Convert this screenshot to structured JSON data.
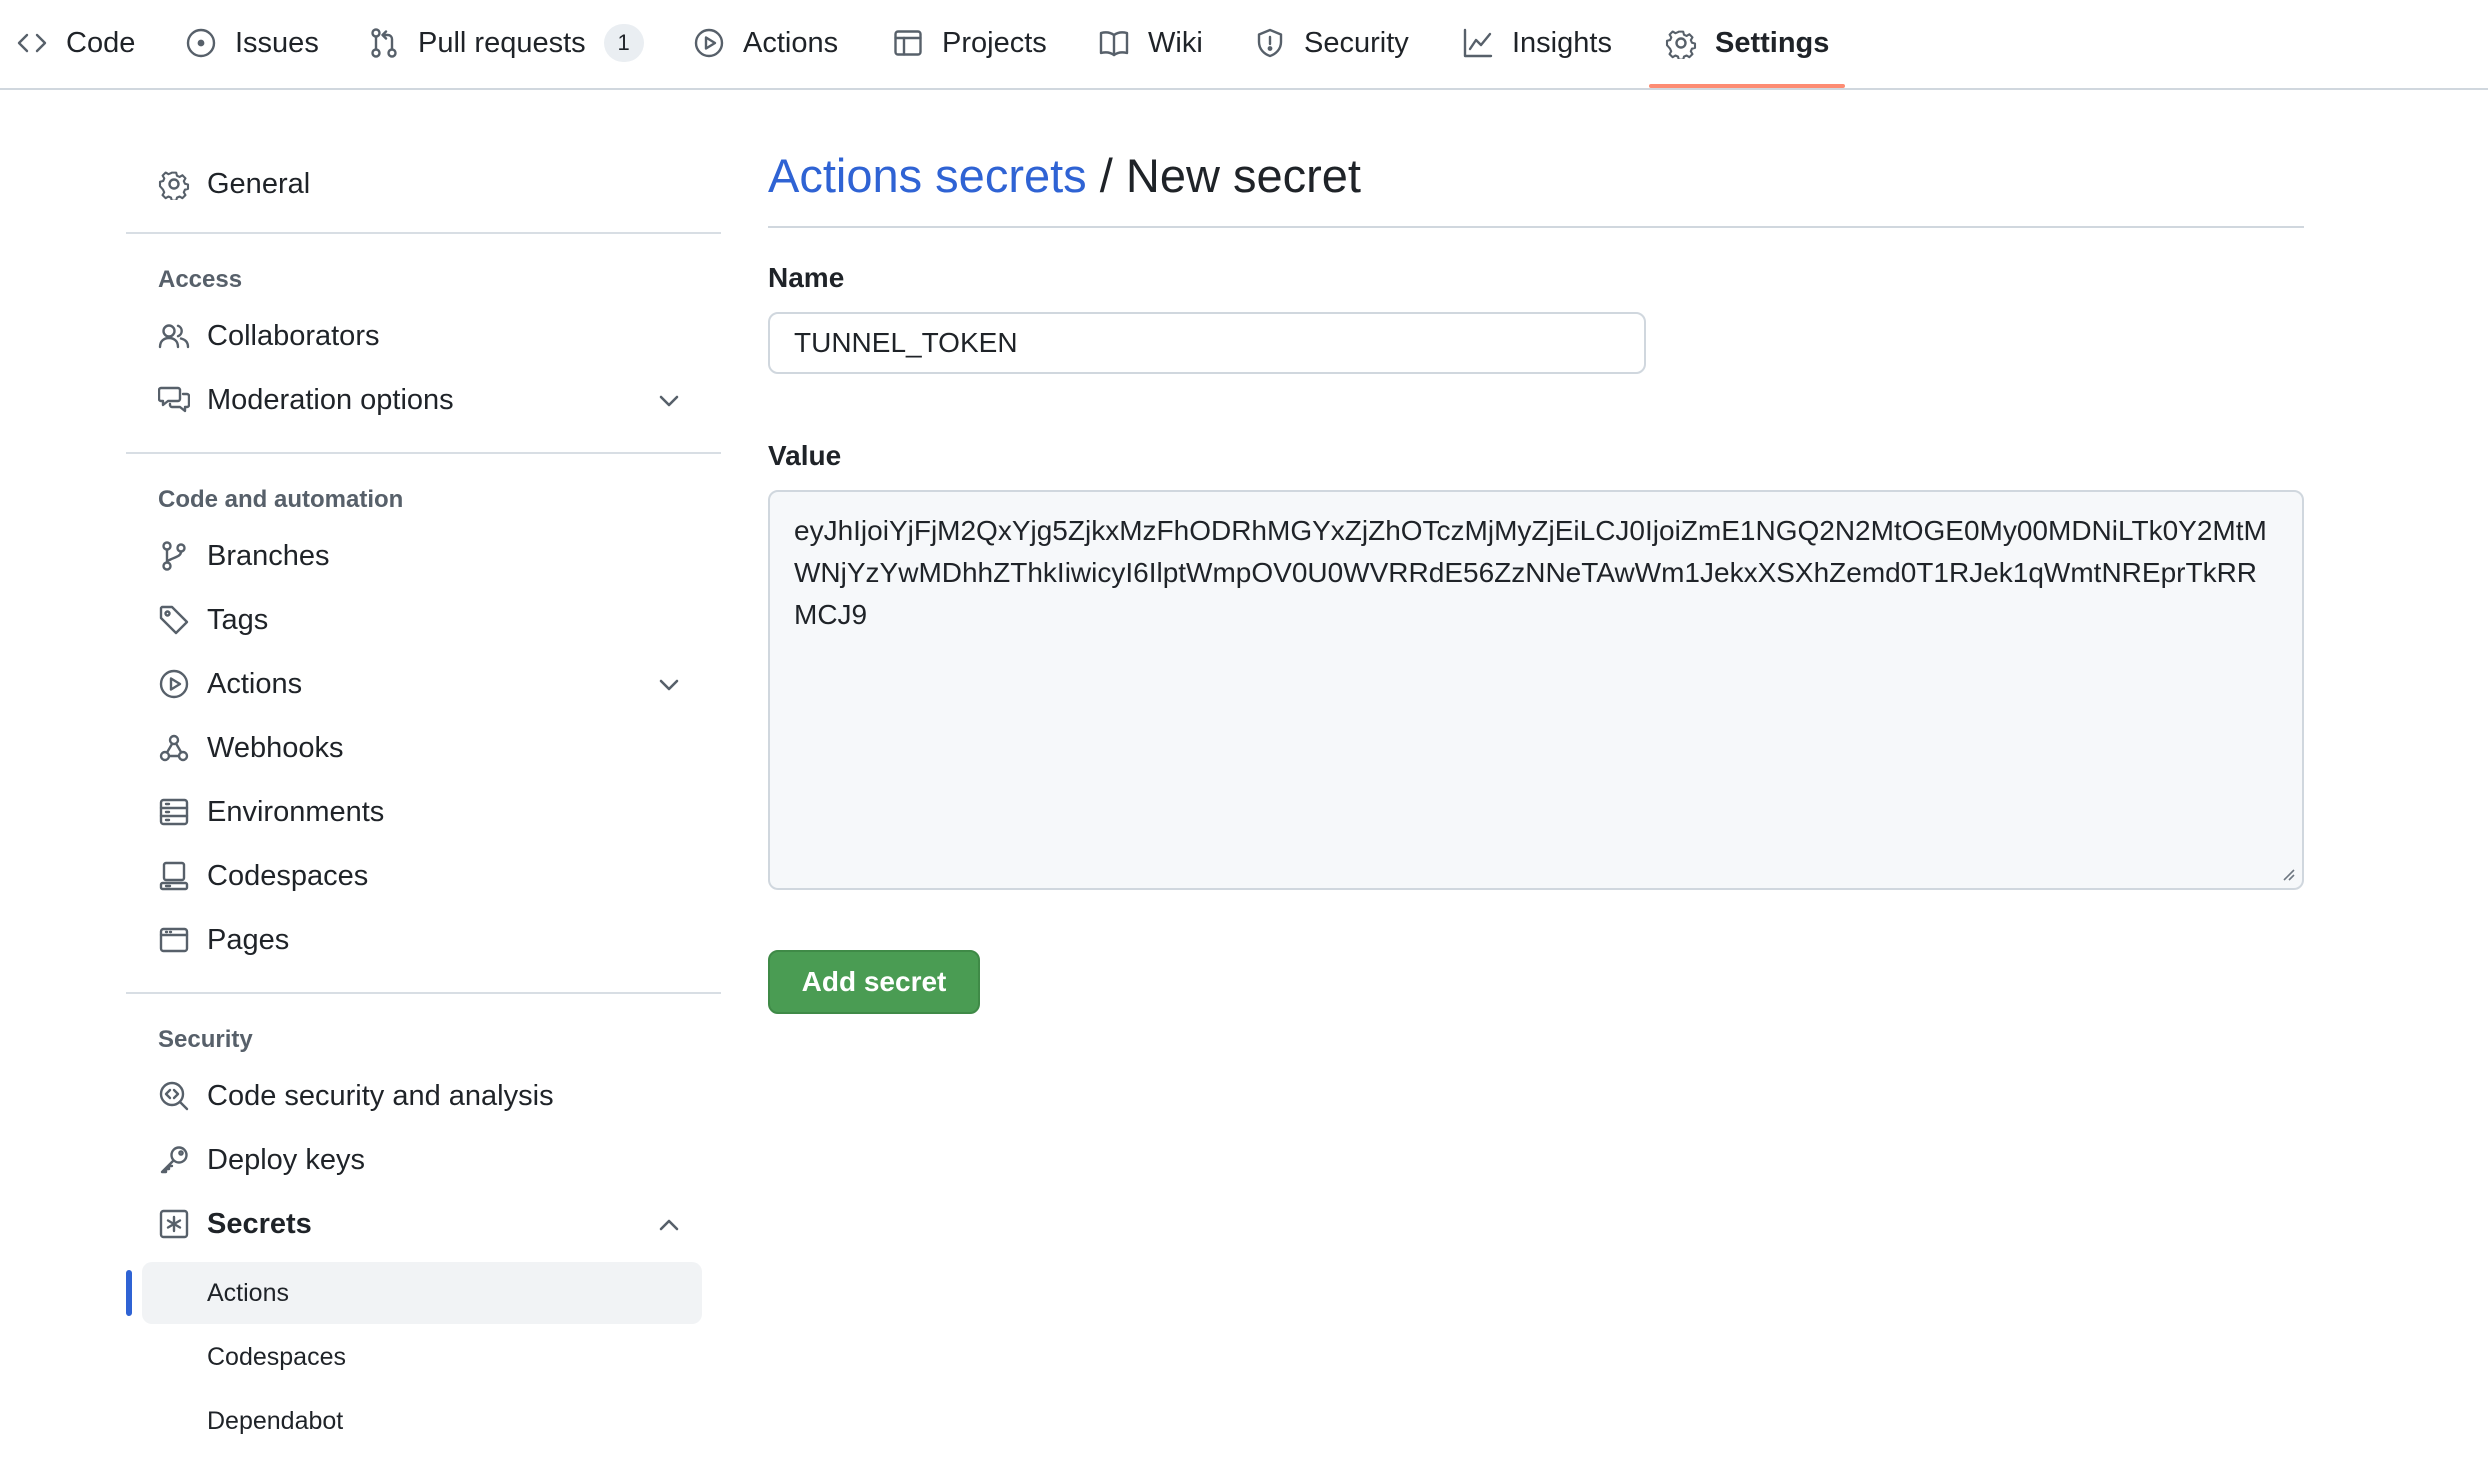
{
  "topnav": {
    "tabs": [
      {
        "label": "Code",
        "icon": "code-icon"
      },
      {
        "label": "Issues",
        "icon": "issue-opened-icon"
      },
      {
        "label": "Pull requests",
        "icon": "git-pull-request-icon",
        "counter": "1"
      },
      {
        "label": "Actions",
        "icon": "play-icon"
      },
      {
        "label": "Projects",
        "icon": "table-icon"
      },
      {
        "label": "Wiki",
        "icon": "book-icon"
      },
      {
        "label": "Security",
        "icon": "shield-icon"
      },
      {
        "label": "Insights",
        "icon": "graph-icon"
      },
      {
        "label": "Settings",
        "icon": "gear-icon",
        "active": true
      }
    ],
    "active_underline_color": "#fd8c73"
  },
  "sidebar": {
    "general": {
      "label": "General",
      "icon": "gear-icon"
    },
    "access": {
      "heading": "Access",
      "items": [
        {
          "label": "Collaborators",
          "icon": "people-icon"
        },
        {
          "label": "Moderation options",
          "icon": "comment-discussion-icon",
          "expandable": true
        }
      ]
    },
    "code_automation": {
      "heading": "Code and automation",
      "items": [
        {
          "label": "Branches",
          "icon": "git-branch-icon"
        },
        {
          "label": "Tags",
          "icon": "tag-icon"
        },
        {
          "label": "Actions",
          "icon": "play-icon",
          "expandable": true
        },
        {
          "label": "Webhooks",
          "icon": "webhook-icon"
        },
        {
          "label": "Environments",
          "icon": "server-icon"
        },
        {
          "label": "Codespaces",
          "icon": "codespaces-icon"
        },
        {
          "label": "Pages",
          "icon": "browser-icon"
        }
      ]
    },
    "security": {
      "heading": "Security",
      "items": [
        {
          "label": "Code security and analysis",
          "icon": "codescan-icon"
        },
        {
          "label": "Deploy keys",
          "icon": "key-icon"
        },
        {
          "label": "Secrets",
          "icon": "key-asterisk-icon",
          "expanded": true
        }
      ],
      "sub_items": [
        {
          "label": "Actions",
          "selected": true
        },
        {
          "label": "Codespaces"
        },
        {
          "label": "Dependabot"
        }
      ]
    }
  },
  "main": {
    "breadcrumb": {
      "parent": "Actions secrets",
      "separator": " / ",
      "current": "New secret"
    },
    "name_label": "Name",
    "name_value": "TUNNEL_TOKEN",
    "value_label": "Value",
    "value_text": "eyJhIjoiYjFjM2QxYjg5ZjkxMzFhODRhMGYxZjZhOTczMjMyZjEiLCJ0IjoiZmE1NGQ2N2MtOGE0My00MDNiLTk0Y2MtMWNjYzYwMDhhZThkIiwicyI6IlptWmpOV0U0WVRRdE56ZzNNeTAwWm1JekxXSXhZemd0T1RJek1qWmtNREprTkRRMCJ9",
    "submit_label": "Add secret",
    "link_color": "#2f63d4",
    "button_color": "#4a9c53"
  }
}
